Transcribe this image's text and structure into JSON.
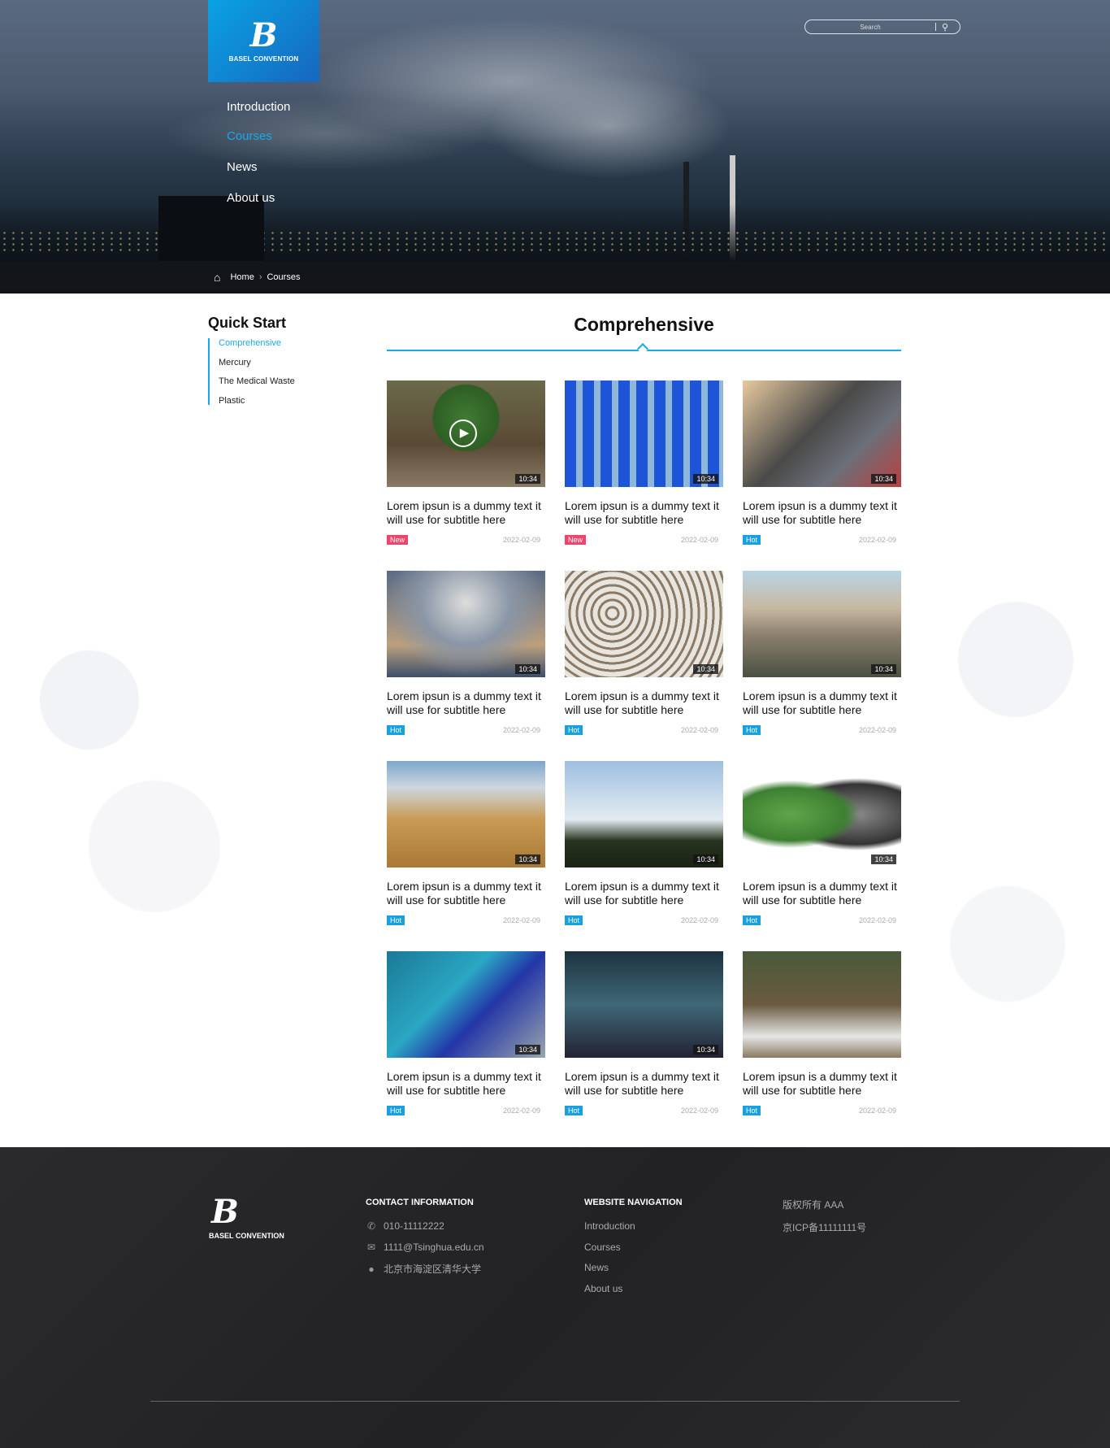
{
  "brand": {
    "name": "BASEL CONVENTION",
    "accent": "#18a9e9",
    "new_color": "#f0456b",
    "hot_color": "#18a0e0"
  },
  "nav": [
    {
      "label": "Introduction",
      "active": false
    },
    {
      "label": "Courses",
      "active": true
    },
    {
      "label": "News",
      "active": false
    },
    {
      "label": "About us",
      "active": false
    }
  ],
  "search": {
    "placeholder": "Search",
    "icon": "search-icon"
  },
  "breadcrumb": {
    "icon": "home-icon",
    "items": [
      "Home",
      "Courses"
    ]
  },
  "sidebar": {
    "title": "Quick Start",
    "items": [
      {
        "label": "Comprehensive",
        "active": true
      },
      {
        "label": "Mercury",
        "active": false
      },
      {
        "label": "The Medical Waste",
        "active": false
      },
      {
        "label": "Plastic",
        "active": false
      }
    ]
  },
  "main": {
    "title": "Comprehensive",
    "cards": [
      {
        "title": "Lorem ipsun is a dummy text it will use for subtitle here",
        "badge": "New",
        "date": "2022-02-09",
        "duration": "10:34",
        "play": true
      },
      {
        "title": "Lorem ipsun is a dummy text it will use for subtitle here",
        "badge": "New",
        "date": "2022-02-09",
        "duration": "10:34"
      },
      {
        "title": "Lorem ipsun is a dummy text it will use for subtitle here",
        "badge": "Hot",
        "date": "2022-02-09",
        "duration": "10:34"
      },
      {
        "title": "Lorem ipsun is a dummy text it will use for subtitle here",
        "badge": "Hot",
        "date": "2022-02-09",
        "duration": "10:34"
      },
      {
        "title": "Lorem ipsun is a dummy text it will use for subtitle here",
        "badge": "Hot",
        "date": "2022-02-09",
        "duration": "10:34"
      },
      {
        "title": "Lorem ipsun is a dummy text it will use for subtitle here",
        "badge": "Hot",
        "date": "2022-02-09",
        "duration": "10:34"
      },
      {
        "title": "Lorem ipsun is a dummy text it will use for subtitle here",
        "badge": "Hot",
        "date": "2022-02-09",
        "duration": "10:34"
      },
      {
        "title": "Lorem ipsun is a dummy text it will use for subtitle here",
        "badge": "Hot",
        "date": "2022-02-09",
        "duration": "10:34"
      },
      {
        "title": "Lorem ipsun is a dummy text it will use for subtitle here",
        "badge": "Hot",
        "date": "2022-02-09",
        "duration": "10:34"
      },
      {
        "title": "Lorem ipsun is a dummy text it will use for subtitle here",
        "badge": "Hot",
        "date": "2022-02-09",
        "duration": "10:34"
      },
      {
        "title": "Lorem ipsun is a dummy text it will use for subtitle here",
        "badge": "Hot",
        "date": "2022-02-09",
        "duration": "10:34"
      },
      {
        "title": "Lorem ipsun is a dummy text it will use for subtitle here",
        "badge": "Hot",
        "date": "2022-02-09",
        "duration": ""
      }
    ]
  },
  "footer": {
    "contact": {
      "heading": "CONTACT INFORMATION",
      "phone": "010-11112222",
      "email": "1111@Tsinghua.edu.cn",
      "address": "北京市海淀区清华大学"
    },
    "navigation": {
      "heading": "WEBSITE NAVIGATION",
      "items": [
        "Introduction",
        "Courses",
        "News",
        "About us"
      ]
    },
    "copyright": "版权所有 AAA",
    "icp": "京ICP备11111111号"
  }
}
